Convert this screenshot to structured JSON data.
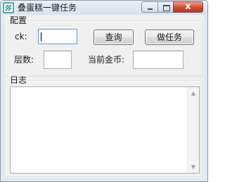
{
  "window": {
    "title": "叠蛋糕一键任务",
    "close_glyph": "x"
  },
  "config": {
    "legend": "配置",
    "ck_label": "ck:",
    "ck_value": "",
    "query_button": "查询",
    "task_button": "做任务",
    "floors_label": "层数:",
    "floors_value": "",
    "coins_label": "当前金币:",
    "coins_value": ""
  },
  "log": {
    "legend": "日志",
    "content": ""
  },
  "icons": {
    "app": "app-logo-icon",
    "minimize": "minimize-icon",
    "maximize": "maximize-icon",
    "close": "close-icon",
    "scroll_up": "scroll-up-arrow-icon",
    "scroll_down": "scroll-down-arrow-icon"
  },
  "colors": {
    "client_bg": "#f0f0f0",
    "close_button": "#c94a32",
    "focus_border": "#569de5",
    "logo": "#1f8f8a"
  }
}
